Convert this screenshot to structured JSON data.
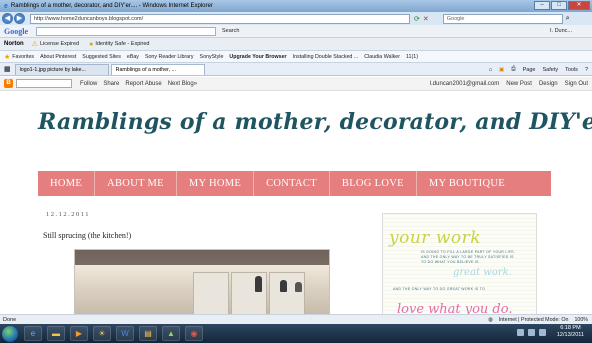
{
  "window": {
    "title": "Ramblings of a mother, decorator, and DIY'er.... - Windows Internet Explorer",
    "controls": {
      "min": "–",
      "max": "□",
      "close": "✕"
    }
  },
  "addressbar": {
    "back_icon": "back-arrow-icon",
    "url": "http://www.home2duncanboys.blogspot.com/",
    "search_placeholder": "Google"
  },
  "google_toolbar": {
    "logo": "Google",
    "search_button": "Search",
    "signin": "I. Dunc..."
  },
  "norton_toolbar": {
    "logo": "Norton",
    "items": [
      "License Expired",
      "Identity Safe - Expired"
    ]
  },
  "favorites": {
    "label": "Favorites",
    "items": [
      "About Pinterest",
      "Suggested Sites",
      "eBay",
      "Sony Reader Library",
      "SonyStyle",
      "Upgrade Your Browser",
      "Installing Double Stacked ...",
      "Claudia Walker",
      "11(1)"
    ]
  },
  "tabs": [
    {
      "label": "logo1-1.jpg picture by lake..."
    },
    {
      "label": "Ramblings of a mother, ..."
    }
  ],
  "commandbar": {
    "page": "Page",
    "safety": "Safety",
    "tools": "Tools"
  },
  "blogger_nav": {
    "left_links": [
      "Follow",
      "Share",
      "Report Abuse",
      "Next Blog»"
    ],
    "right_links": [
      "l.duncan2001@gmail.com",
      "New Post",
      "Design",
      "Sign Out"
    ]
  },
  "blog": {
    "title": "Ramblings of a mother, decorator, and DIY'er...",
    "menu": [
      "HOME",
      "ABOUT ME",
      "MY HOME",
      "CONTACT",
      "BLOG LOVE",
      "MY BOUTIQUE"
    ],
    "post_date": "12.12.2011",
    "post_title": "Still sprucing (the kitchen!)",
    "sidebar_quote": {
      "heading": "your work",
      "line1": "IS GOING TO FILL A LARGE PART OF YOUR LIFE,",
      "line2": "AND THE ONLY WAY TO BE TRULY SATISFIED IS",
      "line3": "TO DO WHAT YOU BELIEVE IS",
      "great": "great work.",
      "line4": "AND THE ONLY WAY TO DO GREAT WORK IS TO",
      "love": "love what you do."
    }
  },
  "statusbar": {
    "status": "Done",
    "zone": "Internet | Protected Mode: On",
    "zoom": "100%"
  },
  "taskbar": {
    "time": "6:18 PM",
    "date": "12/13/2011"
  },
  "colors": {
    "menu_bg": "#e57f7f",
    "title_color": "#1e5561"
  }
}
